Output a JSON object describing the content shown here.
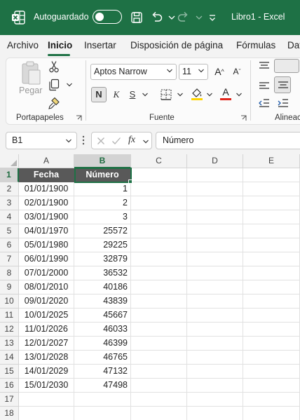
{
  "titlebar": {
    "autosave_label": "Autoguardado",
    "autosave_state": "off",
    "title": "Libro1  -  Excel",
    "accent": "#1e7145"
  },
  "menu": {
    "tabs": [
      "Archivo",
      "Inicio",
      "Insertar",
      "Disposición de página",
      "Fórmulas",
      "Dat"
    ],
    "active": "Inicio"
  },
  "ribbon": {
    "groups": {
      "clipboard": "Portapapeles",
      "font": "Fuente",
      "alignment": "Alineac"
    },
    "paste_label": "Pegar",
    "font_name": "Aptos Narrow",
    "font_size": "11",
    "bold_label": "N",
    "italic_label": "K",
    "underline_label": "S",
    "grow_label": "A",
    "shrink_label": "A",
    "font_color_label": "A"
  },
  "formula_bar": {
    "name_box": "B1",
    "fx_label": "fx",
    "content": "Número"
  },
  "grid": {
    "columns": [
      "A",
      "B",
      "C",
      "D",
      "E"
    ],
    "selected_column": "B",
    "selected_row": 1,
    "rows": [
      {
        "n": "1",
        "a": "Fecha",
        "b": "Número"
      },
      {
        "n": "2",
        "a": "01/01/1900",
        "b": "1"
      },
      {
        "n": "3",
        "a": "02/01/1900",
        "b": "2"
      },
      {
        "n": "4",
        "a": "03/01/1900",
        "b": "3"
      },
      {
        "n": "5",
        "a": "04/01/1970",
        "b": "25572"
      },
      {
        "n": "6",
        "a": "05/01/1980",
        "b": "29225"
      },
      {
        "n": "7",
        "a": "06/01/1990",
        "b": "32879"
      },
      {
        "n": "8",
        "a": "07/01/2000",
        "b": "36532"
      },
      {
        "n": "9",
        "a": "08/01/2010",
        "b": "40186"
      },
      {
        "n": "10",
        "a": "09/01/2020",
        "b": "43839"
      },
      {
        "n": "11",
        "a": "10/01/2025",
        "b": "45667"
      },
      {
        "n": "12",
        "a": "11/01/2026",
        "b": "46033"
      },
      {
        "n": "13",
        "a": "12/01/2027",
        "b": "46399"
      },
      {
        "n": "14",
        "a": "13/01/2028",
        "b": "46765"
      },
      {
        "n": "15",
        "a": "14/01/2029",
        "b": "47132"
      },
      {
        "n": "16",
        "a": "15/01/2030",
        "b": "47498"
      },
      {
        "n": "17",
        "a": "",
        "b": ""
      },
      {
        "n": "18",
        "a": "",
        "b": ""
      }
    ],
    "header_fill": "#595959"
  }
}
